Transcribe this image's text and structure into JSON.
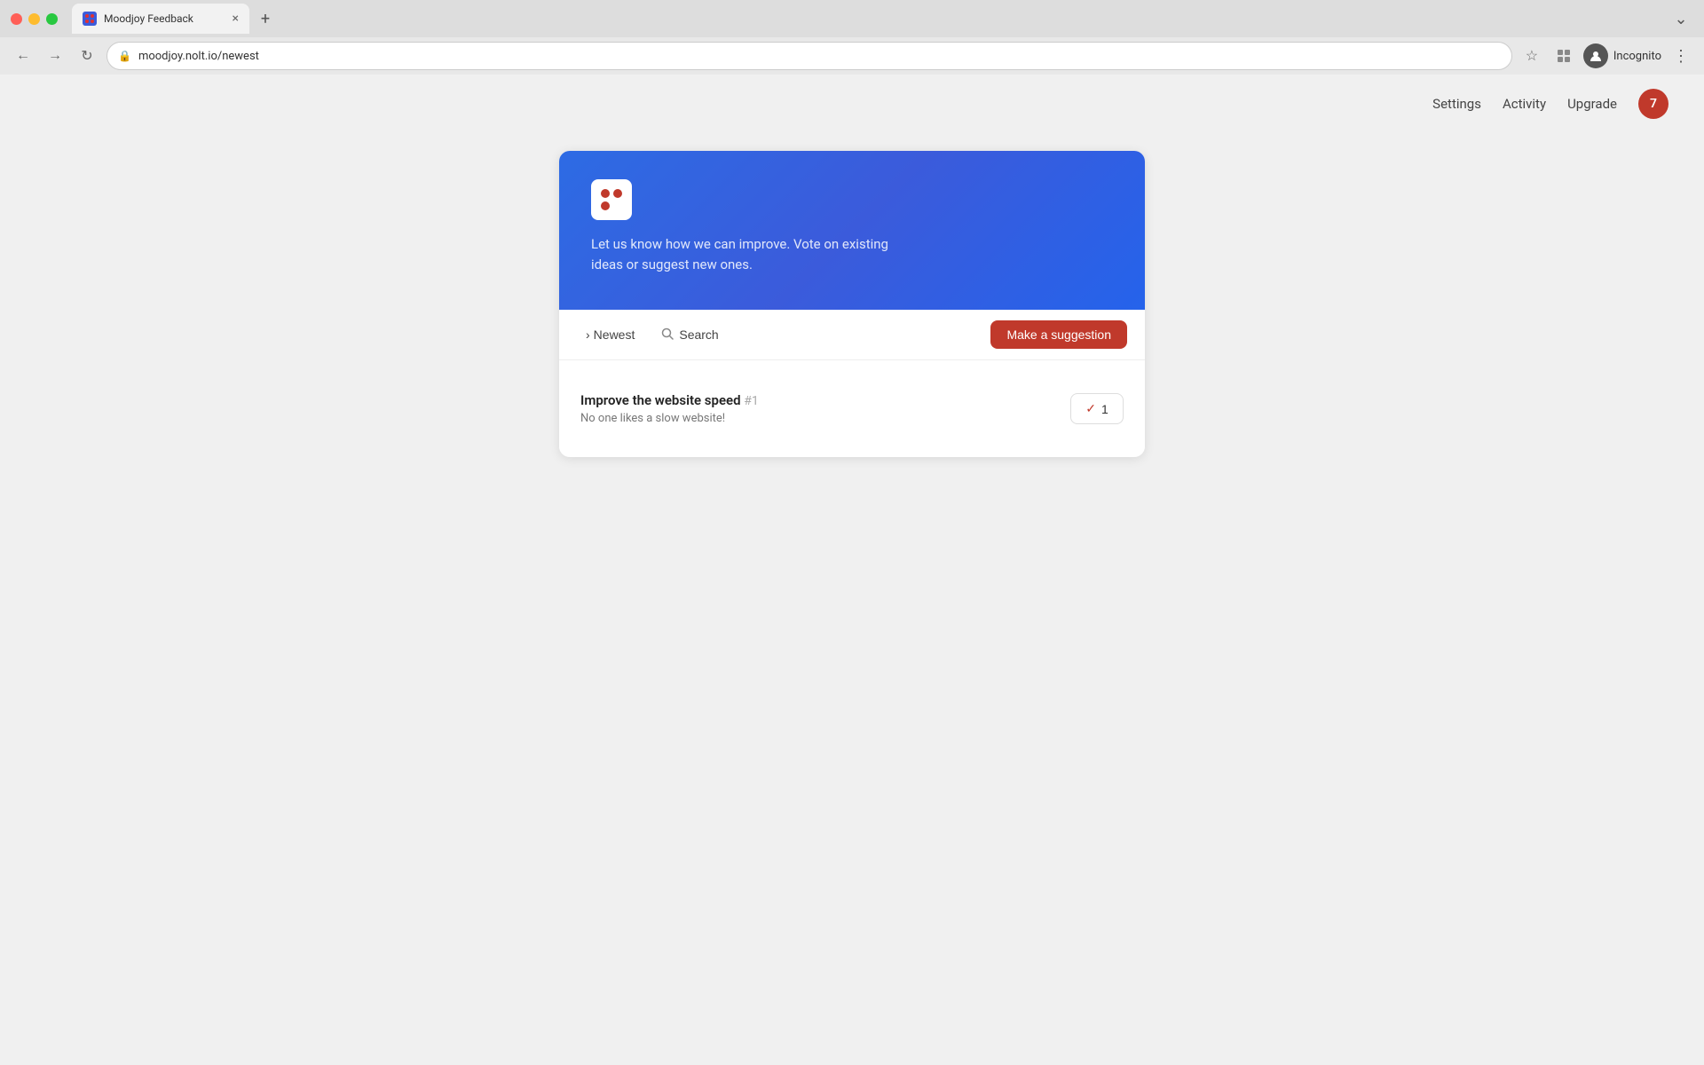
{
  "browser": {
    "tab_title": "Moodjoy Feedback",
    "tab_close": "×",
    "tab_new": "+",
    "url": "moodjoy.nolt.io/newest",
    "back_btn": "←",
    "forward_btn": "→",
    "reload_btn": "↻",
    "bookmark_icon": "☆",
    "incognito_label": "Incognito",
    "incognito_icon": "👤",
    "menu_icon": "⋮",
    "more_tabs_icon": "⌄"
  },
  "header": {
    "settings_label": "Settings",
    "activity_label": "Activity",
    "upgrade_label": "Upgrade",
    "avatar_number": "7"
  },
  "card": {
    "banner": {
      "description": "Let us know how we can improve. Vote on existing ideas or suggest new ones."
    },
    "toolbar": {
      "sort_label": "Newest",
      "sort_icon": "›",
      "search_label": "Search",
      "search_icon": "🔍",
      "suggestion_btn_label": "Make a suggestion"
    },
    "suggestions": [
      {
        "title": "Improve the website speed",
        "number": "#1",
        "description": "No one likes a slow website!",
        "votes": "1",
        "voted": true
      }
    ]
  }
}
